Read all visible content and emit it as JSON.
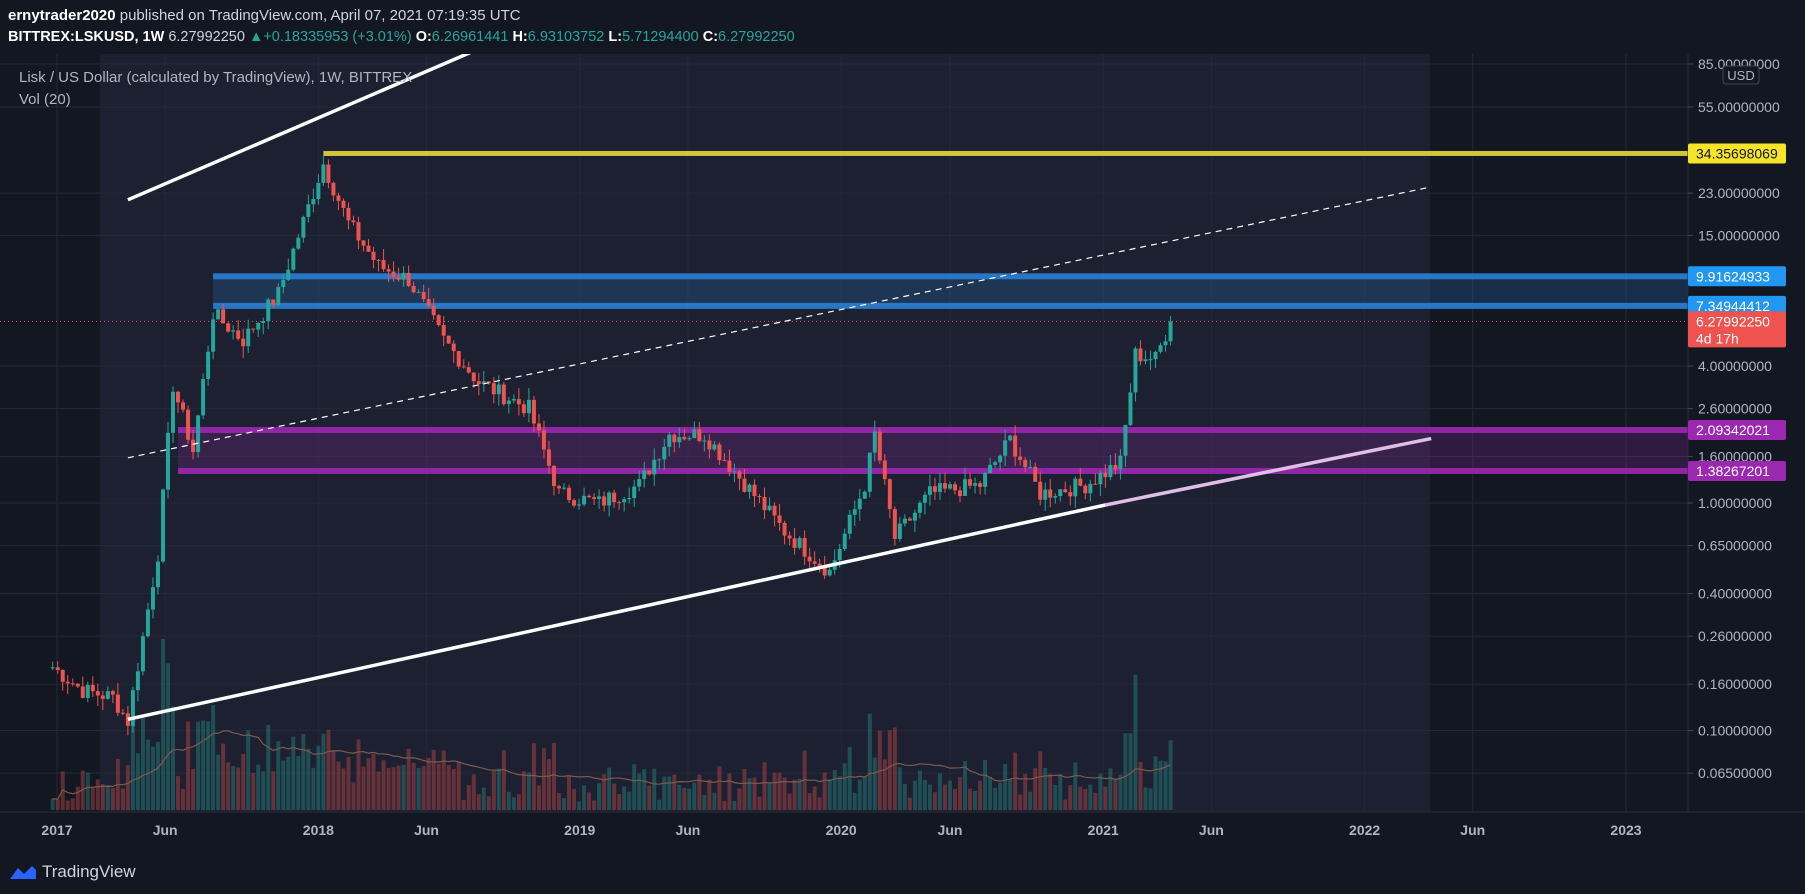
{
  "header": {
    "author": "ernytrader2020",
    "published_text": "published on TradingView.com, April 07, 2021 07:19:35 UTC",
    "symbol": "BITTREX:LSKUSD, 1W",
    "last": "6.27992250",
    "change_arrow": "▲",
    "change": "+0.18335953 (+3.01%)",
    "o_label": "O:",
    "o": "6.26961441",
    "h_label": "H:",
    "h": "6.93103752",
    "l_label": "L:",
    "l": "5.71294400",
    "c_label": "C:",
    "c": "6.27992250"
  },
  "legend": {
    "title": "Lisk / US Dollar (calculated by TradingView), 1W, BITTREX",
    "volume": "Vol (20)"
  },
  "footer": {
    "brand": "TradingView"
  },
  "colors": {
    "background": "#131722",
    "up": "#26a69a",
    "down": "#ef5350",
    "resistance_yellow": "#d2c53a",
    "zone_blue": "#2a7fd4",
    "zone_purple": "#9c27b0",
    "price_label_red": "#ef5350"
  },
  "chart_data": {
    "type": "candlestick",
    "symbol": "BITTREX:LSKUSD",
    "interval": "1W",
    "y_scale": "log",
    "currency": "USD",
    "y_ticks": [
      0.065,
      0.1,
      0.16,
      0.26,
      0.4,
      0.65,
      1.0,
      1.6,
      2.6,
      4.0,
      15.0,
      23.0,
      55.0,
      85.0
    ],
    "y_tick_labels": [
      "0.06500000",
      "0.10000000",
      "0.16000000",
      "0.26000000",
      "0.40000000",
      "0.65000000",
      "1.00000000",
      "1.60000000",
      "2.60000000",
      "4.00000000",
      "15.00000000",
      "23.00000000",
      "55.00000000",
      "85.00000000"
    ],
    "x_ticks": [
      "2017-01-01",
      "2017-06-01",
      "2018-01-01",
      "2018-06-01",
      "2019-01-01",
      "2019-06-01",
      "2020-01-01",
      "2020-06-01",
      "2021-01-01",
      "2021-06-01",
      "2022-01-01",
      "2022-06-01",
      "2023-01-01"
    ],
    "x_tick_labels": [
      "2017",
      "Jun",
      "2018",
      "Jun",
      "2019",
      "Jun",
      "2020",
      "Jun",
      "2021",
      "Jun",
      "2022",
      "Jun",
      "2023"
    ],
    "price_levels": [
      {
        "value": 34.35698069,
        "label": "34.35698069",
        "color": "#d2c53a"
      },
      {
        "value": 9.91624933,
        "label": "9.91624933",
        "color": "#2a7fd4"
      },
      {
        "value": 7.34944412,
        "label": "7.34944412",
        "color": "#2a7fd4"
      },
      {
        "value": 2.09342021,
        "label": "2.09342021",
        "color": "#9c27b0"
      },
      {
        "value": 1.38267201,
        "label": "1.38267201",
        "color": "#9c27b0"
      }
    ],
    "last_price": {
      "value": 6.2799225,
      "label": "6.27992250",
      "countdown": "4d 17h"
    },
    "zones": [
      {
        "name": "blue-zone",
        "start": "2017-08-07",
        "from": 7.34944412,
        "to": 9.91624933,
        "color": "#2a7fd4"
      },
      {
        "name": "purple-zone",
        "start": "2017-06-19",
        "from": 1.38267201,
        "to": 2.09342021,
        "color": "#9c27b0"
      }
    ],
    "resistance": {
      "start": "2018-01-08",
      "value": 34.35698069,
      "color": "#d2c53a"
    },
    "trendlines": [
      {
        "name": "upper-channel-line",
        "p1": [
          "2017-04-10",
          21.5
        ],
        "p2": [
          "2019-01-14",
          160
        ],
        "style": "solid",
        "color": "#ffffff"
      },
      {
        "name": "lower-channel-line",
        "p1": [
          "2017-04-10",
          0.112
        ],
        "p2": [
          "2021-01-04",
          0.98
        ],
        "style": "solid",
        "color": "#ffffff"
      },
      {
        "name": "lower-channel-extension",
        "p1": [
          "2021-01-04",
          0.98
        ],
        "p2": [
          "2022-04-04",
          1.92
        ],
        "style": "solid",
        "color": "#e1bee7"
      },
      {
        "name": "mid-channel-line",
        "p1": [
          "2017-04-10",
          1.58
        ],
        "p2": [
          "2022-04-04",
          24.5
        ],
        "style": "dashed",
        "color": "#ffffff"
      }
    ],
    "price_anchors": [
      [
        "2016-12-26",
        0.19
      ],
      [
        "2017-02-06",
        0.15
      ],
      [
        "2017-03-20",
        0.14
      ],
      [
        "2017-04-10",
        0.11
      ],
      [
        "2017-05-22",
        0.6
      ],
      [
        "2017-06-12",
        3.3
      ],
      [
        "2017-07-10",
        1.7
      ],
      [
        "2017-08-07",
        6.8
      ],
      [
        "2017-09-18",
        5.2
      ],
      [
        "2017-11-06",
        8.3
      ],
      [
        "2018-01-08",
        31
      ],
      [
        "2018-02-12",
        17
      ],
      [
        "2018-03-26",
        11
      ],
      [
        "2018-05-07",
        9.6
      ],
      [
        "2018-06-25",
        5.2
      ],
      [
        "2018-08-13",
        3.4
      ],
      [
        "2018-10-22",
        2.6
      ],
      [
        "2018-12-03",
        1.1
      ],
      [
        "2019-01-28",
        1.0
      ],
      [
        "2019-03-25",
        1.2
      ],
      [
        "2019-05-06",
        2.0
      ],
      [
        "2019-06-24",
        2.0
      ],
      [
        "2019-08-12",
        1.3
      ],
      [
        "2019-10-14",
        0.75
      ],
      [
        "2019-12-16",
        0.5
      ],
      [
        "2020-02-03",
        1.2
      ],
      [
        "2020-02-17",
        2.0
      ],
      [
        "2020-03-16",
        0.7
      ],
      [
        "2020-05-04",
        1.1
      ],
      [
        "2020-07-13",
        1.2
      ],
      [
        "2020-08-24",
        1.9
      ],
      [
        "2020-10-05",
        1.1
      ],
      [
        "2020-12-07",
        1.2
      ],
      [
        "2021-01-25",
        1.5
      ],
      [
        "2021-02-15",
        4.5
      ],
      [
        "2021-03-15",
        4.3
      ],
      [
        "2021-04-05",
        6.28
      ]
    ],
    "volume_ma_label": "Vol (20)"
  }
}
